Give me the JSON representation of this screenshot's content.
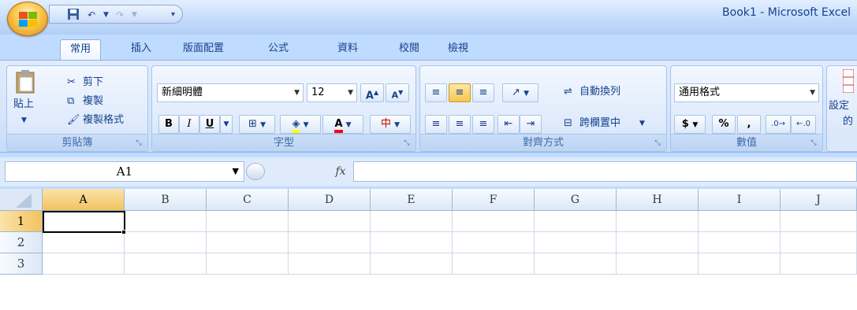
{
  "window": {
    "title": "Book1 - Microsoft Excel"
  },
  "tabs": [
    "常用",
    "插入",
    "版面配置",
    "公式",
    "資料",
    "校閱",
    "檢視"
  ],
  "clipboard": {
    "paste": "貼上",
    "cut": "剪下",
    "copy": "複製",
    "format_painter": "複製格式",
    "caption": "剪貼簿"
  },
  "font": {
    "name": "新細明體",
    "size": "12",
    "bold": "B",
    "italic": "I",
    "underline": "U",
    "font_color": "A",
    "caption": "字型"
  },
  "alignment": {
    "wrap_text": "自動換列",
    "merge_center": "跨欄置中",
    "caption": "對齊方式"
  },
  "number": {
    "format": "通用格式",
    "currency": "$",
    "percent": "%",
    "comma": ",",
    "caption": "數值"
  },
  "styles": {
    "conditional": "設定",
    "format_as": "的"
  },
  "formula_bar": {
    "name_box": "A1",
    "fx": "fx"
  },
  "sheet": {
    "columns": [
      "A",
      "B",
      "C",
      "D",
      "E",
      "F",
      "G",
      "H",
      "I",
      "J"
    ],
    "rows": [
      "1",
      "2",
      "3"
    ],
    "selected_cell": "A1"
  },
  "colors": {
    "accent": "#15428b",
    "selection": "#f3c25f"
  }
}
